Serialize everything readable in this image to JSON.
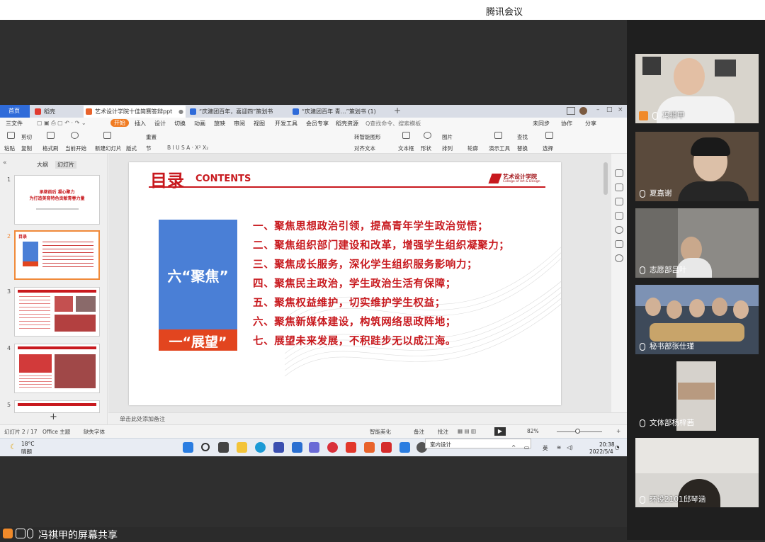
{
  "meeting": {
    "app_title": "腾讯会议",
    "share_label": "冯祺甲的屏幕共享"
  },
  "wps": {
    "tabs": [
      {
        "label": "首页"
      },
      {
        "label": "稻壳"
      },
      {
        "label": "艺术设计学院十佳简赛答辩ppt"
      },
      {
        "label": "“庆建团百年，喜迎四”策划书"
      },
      {
        "label": "“庆建团百年 青…”策划书 (1)"
      }
    ],
    "menus": [
      "三文件",
      "开始",
      "插入",
      "设计",
      "切换",
      "动画",
      "放映",
      "审阅",
      "视图",
      "开发工具",
      "会员专享",
      "稻壳资源",
      "Q查找命令、搜索模板"
    ],
    "menu_right": [
      "未同步",
      "协作",
      "分享"
    ],
    "ribbon": {
      "cut": "剪切",
      "paste": "粘贴",
      "copy": "复制",
      "format_painter": "格式刷",
      "play_from_current": "当前开始",
      "new_slide": "新建幻灯片",
      "layout": "版式",
      "section": "节",
      "reset": "重置",
      "textbox": "文本框",
      "shape": "形状",
      "picture": "图片",
      "arrange": "排列",
      "rotate": "旋转",
      "outline": "轮廓",
      "presenter_tools": "演示工具",
      "find": "查找",
      "replace": "替换",
      "select": "选择",
      "smart_shape": "转智能图形",
      "align_text": "对齐文本"
    },
    "panel_tabs": {
      "outline": "大纲",
      "slides": "幻灯片"
    },
    "thumb_numbers": [
      "1",
      "2",
      "3",
      "4",
      "5"
    ],
    "thumb1": {
      "line1": "承继前后 凝心聚力",
      "line2": "为打造美育特色贡献青春力量"
    },
    "thumb2_title": "目录",
    "notes_hint": "单击此处添加备注",
    "status": {
      "slide_pos": "幻灯片 2 / 17",
      "theme": "Office 主题",
      "font_missing": "缺失字体",
      "beautify": "智能美化",
      "notes": "备注",
      "comments": "批注",
      "zoom": "82%"
    },
    "taskbar": {
      "temp": "18°C",
      "weather": "晴朗",
      "tooltip": "室内设计",
      "ime": "英",
      "time": "20:38",
      "date": "2022/5/4"
    }
  },
  "slide": {
    "title": "目录",
    "subtitle": "CONTENTS",
    "logo_cn": "艺术设计学院",
    "logo_en": "College of Art & Design",
    "box_top": "六“聚焦”",
    "box_bottom": "一“展望”",
    "items": [
      "一、聚焦思想政治引领，提高青年学生政治觉悟；",
      "二、聚焦组织部门建设和改革，增强学生组织凝聚力；",
      "三、聚焦成长服务，深化学生组织服务影响力；",
      "四、聚焦民主政治，学生政治生活有保障；",
      "五、聚焦权益维护，切实维护学生权益；",
      "六、聚焦新媒体建设，构筑网络思政阵地；",
      "七、展望未来发展，不积跬步无以成江海。"
    ]
  },
  "participants": [
    {
      "name": "冯祺甲"
    },
    {
      "name": "夏嘉谢"
    },
    {
      "name": "志愿部吕叶"
    },
    {
      "name": "秘书部张仕瑾"
    },
    {
      "name": "文体部杨梓茜"
    },
    {
      "name": "环设2101邱琴涵"
    }
  ]
}
